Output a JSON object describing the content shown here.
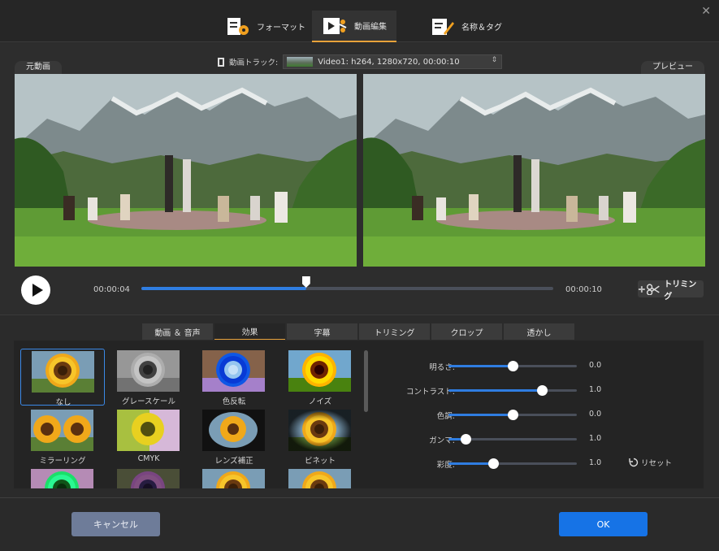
{
  "main_tabs": [
    {
      "label": "フォーマット",
      "icon": "format-settings-icon"
    },
    {
      "label": "動画編集",
      "icon": "video-edit-icon"
    },
    {
      "label": "名称＆タグ",
      "icon": "name-tag-icon"
    }
  ],
  "active_main_tab": "動画編集",
  "close_label": "✕",
  "video": {
    "source_label": "元動画",
    "preview_label": "プレビュー",
    "track_label": "動画トラック:",
    "track_value": "Video1: h264, 1280x720, 00:00:10"
  },
  "playback": {
    "current_time": "00:00:04",
    "total_time": "00:00:10",
    "progress": 0.4,
    "trim_label": "トリミング"
  },
  "edit_tabs": [
    "動画 ＆ 音声",
    "効果",
    "字幕",
    "トリミング",
    "クロップ",
    "透かし"
  ],
  "active_edit_tab": "効果",
  "effects": [
    {
      "label": "なし",
      "selected": true
    },
    {
      "label": "グレースケール"
    },
    {
      "label": "色反転"
    },
    {
      "label": "ノイズ"
    },
    {
      "label": "ミラーリング"
    },
    {
      "label": "CMYK"
    },
    {
      "label": "レンズ補正"
    },
    {
      "label": "ビネット"
    },
    {
      "label": ""
    },
    {
      "label": ""
    },
    {
      "label": ""
    },
    {
      "label": ""
    }
  ],
  "adjustments": [
    {
      "label": "明るさ:",
      "value": "0.0",
      "fraction": 0.5
    },
    {
      "label": "コントラスト:",
      "value": "1.0",
      "fraction": 0.73
    },
    {
      "label": "色調:",
      "value": "0.0",
      "fraction": 0.5
    },
    {
      "label": "ガンマ:",
      "value": "1.0",
      "fraction": 0.13
    },
    {
      "label": "彩度:",
      "value": "1.0",
      "fraction": 0.35
    }
  ],
  "reset_label": "リセット",
  "footer": {
    "cancel_label": "キャンセル",
    "ok_label": "OK"
  },
  "colors": {
    "accent": "#1673e6",
    "tab_underline": "#e8a23a",
    "cancel": "#6e7c99"
  }
}
